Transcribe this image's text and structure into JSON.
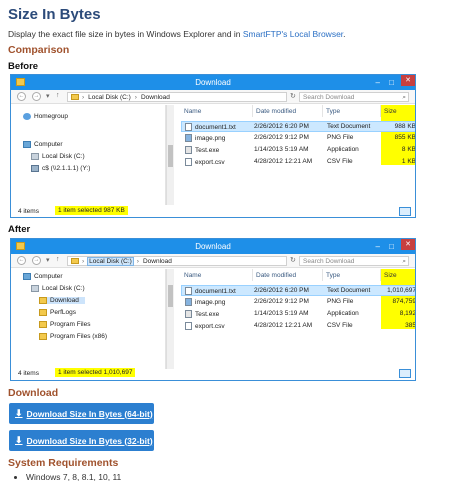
{
  "page": {
    "title": "Size In Bytes",
    "intro_text": "Display the exact file size in bytes in Windows Explorer and in ",
    "intro_link": "SmartFTP's Local Browser",
    "intro_end": "."
  },
  "comparison": {
    "heading": "Comparison",
    "before_label": "Before",
    "after_label": "After"
  },
  "before": {
    "window_title": "Download",
    "address": [
      "Local Disk (C:)",
      "Download"
    ],
    "search_placeholder": "Search Download",
    "nav": [
      {
        "label": "Homegroup",
        "icon": "homegroup-icon"
      },
      {
        "label": "Computer",
        "icon": "computer-icon"
      },
      {
        "label": "Local Disk (C:)",
        "icon": "disk-icon"
      },
      {
        "label": "c$ (\\\\2.1.1.1) (Y:)",
        "icon": "network-drive-icon"
      }
    ],
    "columns": [
      "Name",
      "Date modified",
      "Type",
      "Size"
    ],
    "files": [
      {
        "name": "document1.txt",
        "date": "2/26/2012 6:20 PM",
        "type": "Text Document",
        "size": "988 KB",
        "icon": "text-file-icon"
      },
      {
        "name": "image.png",
        "date": "2/26/2012 9:12 PM",
        "type": "PNG File",
        "size": "855 KB",
        "icon": "image-file-icon"
      },
      {
        "name": "Test.exe",
        "date": "1/14/2013 5:19 AM",
        "type": "Application",
        "size": "8 KB",
        "icon": "exe-file-icon"
      },
      {
        "name": "export.csv",
        "date": "4/28/2012 12:21 AM",
        "type": "CSV File",
        "size": "1 KB",
        "icon": "csv-file-icon"
      }
    ],
    "status_count": "4 items",
    "status_selected": "1 item selected  987 KB"
  },
  "after": {
    "window_title": "Download",
    "address": [
      "Local Disk (C:)",
      "Download"
    ],
    "search_placeholder": "Search Download",
    "nav": [
      {
        "label": "Computer",
        "icon": "computer-icon"
      },
      {
        "label": "Local Disk (C:)",
        "icon": "disk-icon"
      },
      {
        "label": "Download",
        "icon": "folder-icon"
      },
      {
        "label": "PerfLogs",
        "icon": "folder-icon"
      },
      {
        "label": "Program Files",
        "icon": "folder-icon"
      },
      {
        "label": "Program Files (x86)",
        "icon": "folder-icon"
      }
    ],
    "columns": [
      "Name",
      "Date modified",
      "Type",
      "Size"
    ],
    "files": [
      {
        "name": "document1.txt",
        "date": "2/26/2012 6:20 PM",
        "type": "Text Document",
        "size": "1,010,697",
        "icon": "text-file-icon"
      },
      {
        "name": "image.png",
        "date": "2/26/2012 9:12 PM",
        "type": "PNG File",
        "size": "874,759",
        "icon": "image-file-icon"
      },
      {
        "name": "Test.exe",
        "date": "1/14/2013 5:19 AM",
        "type": "Application",
        "size": "8,192",
        "icon": "exe-file-icon"
      },
      {
        "name": "export.csv",
        "date": "4/28/2012 12:21 AM",
        "type": "CSV File",
        "size": "385",
        "icon": "csv-file-icon"
      }
    ],
    "status_count": "4 items",
    "status_selected": "1 item selected  1,010,697"
  },
  "download": {
    "heading": "Download",
    "btn64": "Download Size In Bytes (64-bit)",
    "btn32": "Download Size In Bytes (32-bit)"
  },
  "requirements": {
    "heading": "System Requirements",
    "items": [
      "Windows 7, 8, 8.1, 10, 11"
    ]
  },
  "colors": {
    "highlight": "#ffff00",
    "titlebar": "#1e8fe8",
    "button": "#2c7fd0",
    "heading": "#a0522d"
  }
}
